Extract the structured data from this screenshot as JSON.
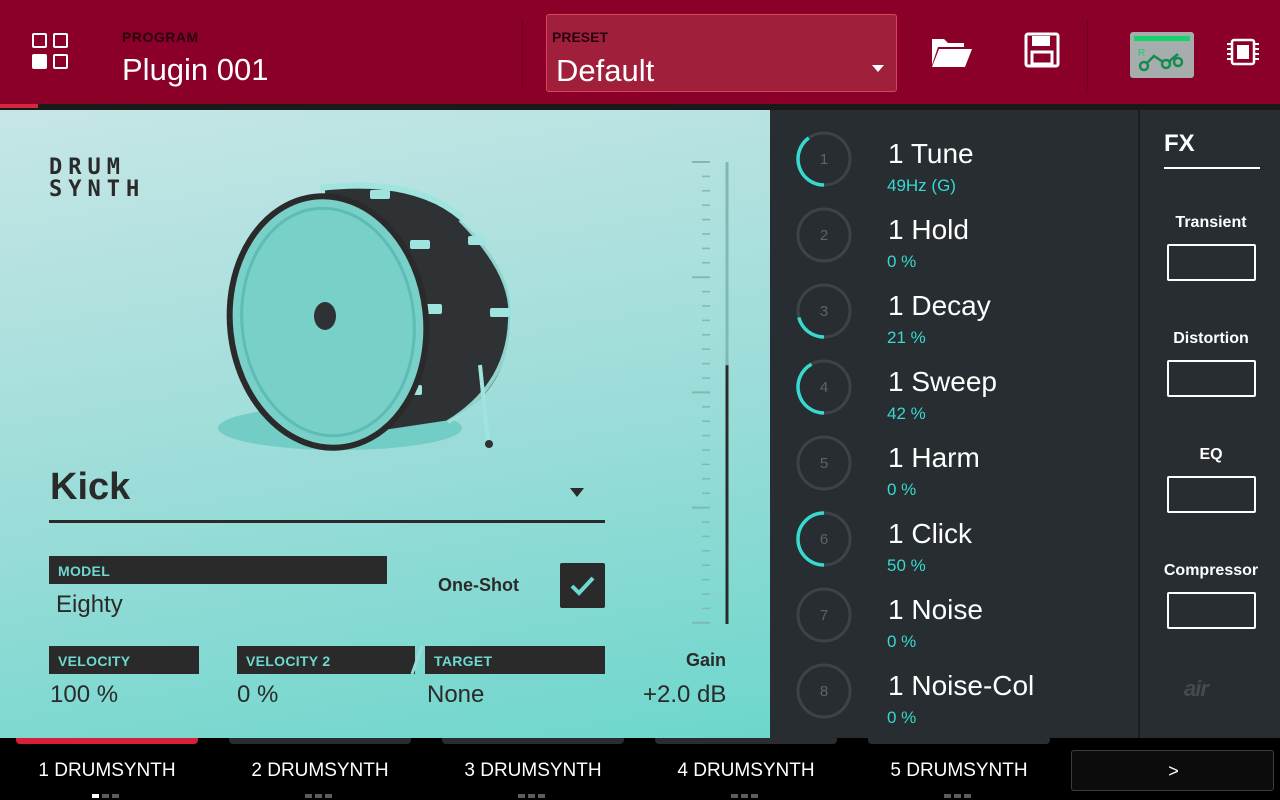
{
  "header": {
    "program_label": "PROGRAM",
    "program_name": "Plugin 001",
    "preset_label": "PRESET",
    "preset_value": "Default"
  },
  "instrument": {
    "logo_line1": "DRUM",
    "logo_line2": "SYNTH",
    "drum_type": "Kick",
    "model_label": "MODEL",
    "model_value": "Eighty",
    "oneshot_label": "One-Shot",
    "oneshot_checked": true,
    "velocity_label": "VELOCITY",
    "velocity_value": "100 %",
    "velocity2_label": "VELOCITY 2",
    "velocity2_value": "0 %",
    "target_label": "TARGET",
    "target_value": "None",
    "gain_label": "Gain",
    "gain_value": "+2.0 dB",
    "gain_level": 0.56
  },
  "knobs": [
    {
      "num": "1",
      "name": "1 Tune",
      "value": "49Hz (G)",
      "level": 0.4
    },
    {
      "num": "2",
      "name": "1 Hold",
      "value": "0 %",
      "level": 0.0
    },
    {
      "num": "3",
      "name": "1 Decay",
      "value": "21 %",
      "level": 0.21
    },
    {
      "num": "4",
      "name": "1 Sweep",
      "value": "42 %",
      "level": 0.42
    },
    {
      "num": "5",
      "name": "1 Harm",
      "value": "0 %",
      "level": 0.0
    },
    {
      "num": "6",
      "name": "1 Click",
      "value": "50 %",
      "level": 0.5
    },
    {
      "num": "7",
      "name": "1 Noise",
      "value": "0 %",
      "level": 0.0
    },
    {
      "num": "8",
      "name": "1 Noise-Col",
      "value": "0 %",
      "level": 0.0
    }
  ],
  "fx": {
    "title": "FX",
    "slots": [
      "Transient",
      "Distortion",
      "EQ",
      "Compressor"
    ],
    "brand": "air"
  },
  "tabs": {
    "items": [
      "1 DRUMSYNTH",
      "2 DRUMSYNTH",
      "3 DRUMSYNTH",
      "4 DRUMSYNTH",
      "5 DRUMSYNTH"
    ],
    "active_index": 0,
    "next_label": ">"
  },
  "colors": {
    "header_bg": "#8a0028",
    "accent_cyan": "#37d9d0",
    "active_tab": "#d8203a",
    "panel_dark": "#272d30"
  }
}
